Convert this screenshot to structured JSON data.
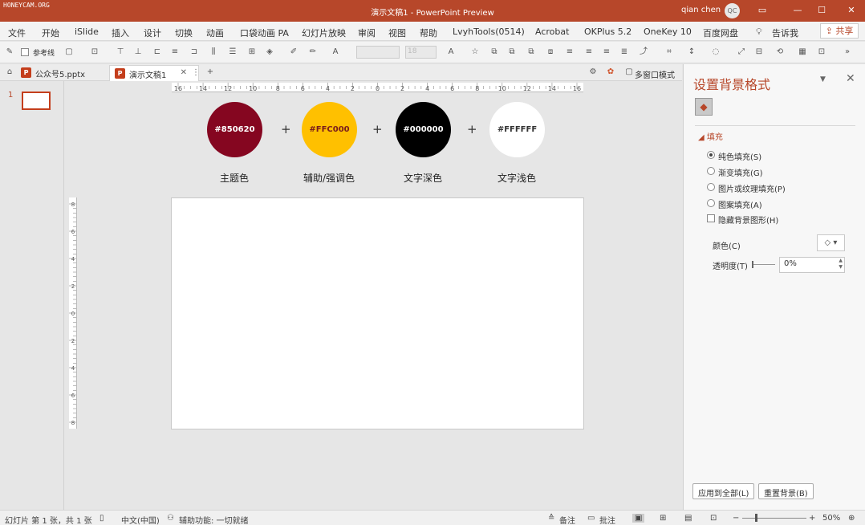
{
  "titlebar": {
    "watermark": "HONEYCAM.ORG",
    "title": "演示文稿1  -  PowerPoint Preview",
    "user": "qian chen",
    "avatar": "QC",
    "buttons": [
      "ribbon-display-icon",
      "minimize-icon",
      "maximize-icon",
      "close-icon"
    ]
  },
  "menu": {
    "items": [
      "文件",
      "开始",
      "iSlide",
      "插入",
      "设计",
      "切换",
      "动画",
      "口袋动画 PA",
      "幻灯片放映",
      "审阅",
      "视图",
      "帮助",
      "LvyhTools(0514)",
      "Acrobat",
      "OKPlus 5.2",
      "OneKey 10",
      "百度网盘"
    ],
    "tell_me": "告诉我",
    "share": "共享"
  },
  "toolbar": {
    "guide_label": "参考线",
    "font_size": "18"
  },
  "tabs": {
    "items": [
      "公众号5.pptx",
      "演示文稿1"
    ],
    "multiwindow": "多窗口模式"
  },
  "thumbnails": {
    "slide_number": "1"
  },
  "swatches": [
    {
      "hex": "#850620",
      "color": "#850620",
      "text_color": "#ffffff",
      "label": "主题色"
    },
    {
      "hex": "#FFC000",
      "color": "#ffc000",
      "text_color": "#7a1c1c",
      "label": "辅助/强调色"
    },
    {
      "hex": "#000000",
      "color": "#000000",
      "text_color": "#ffffff",
      "label": "文字深色"
    },
    {
      "hex": "#FFFFFF",
      "color": "#ffffff",
      "text_color": "#333333",
      "label": "文字浅色"
    }
  ],
  "plus_sign": "+",
  "ruler": {
    "h_numbers": [
      "16",
      "14",
      "12",
      "10",
      "8",
      "6",
      "4",
      "2",
      "0",
      "2",
      "4",
      "6",
      "8",
      "10",
      "12",
      "14",
      "16"
    ],
    "v_numbers": [
      "8",
      "6",
      "4",
      "2",
      "0",
      "2",
      "4",
      "6",
      "8"
    ]
  },
  "format_panel": {
    "title": "设置背景格式",
    "section": "填充",
    "options": [
      "纯色填充(S)",
      "渐变填充(G)",
      "图片或纹理填充(P)",
      "图案填充(A)"
    ],
    "selected_option": "纯色填充(S)",
    "hide_graphics": "隐藏背景图形(H)",
    "color_label": "颜色(C)",
    "transparency_label": "透明度(T)",
    "transparency_value": "0%",
    "apply_all": "应用到全部(L)",
    "reset": "重置背景(B)"
  },
  "statusbar": {
    "slide_info": "幻灯片 第 1 张，共 1 张",
    "language": "中文(中国)",
    "accessibility": "辅助功能: 一切就绪",
    "notes": "备注",
    "comments": "批注",
    "zoom": "50%"
  }
}
